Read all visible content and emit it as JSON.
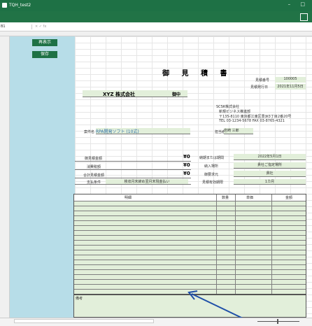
{
  "window": {
    "title": "TQH_test2"
  },
  "formula_bar": {
    "name_box": "B1",
    "fx": "× ✓ fx"
  },
  "side_buttons": {
    "redisplay": "再表示",
    "save": "保存"
  },
  "doc": {
    "title": "御 見 積 書",
    "estimate_no_label": "見積番号",
    "estimate_no": "100005",
    "issue_date_label": "見積発行日",
    "issue_date": "2021年11月5日",
    "client": "XYZ 株式会社",
    "honorific": "御中",
    "company": "SCSK株式会社",
    "dept": "新規ビジネス推進部",
    "address": "〒135-8110 東京都江東区豊洲3丁目2番20号",
    "tel": "TEL 03-1234-5678 FAX 03-8765-4321",
    "project_label": "案件名",
    "project": "RPA開発ソフト (10式)",
    "person_label": "担当者",
    "person": "岩崎 三郎",
    "total_label": "御見積金額",
    "total": "¥0",
    "tax_label": "消費税額",
    "tax": "¥0",
    "grand_label": "合計見積金額",
    "grand": "¥0",
    "payment_label": "支払条件",
    "payment": "検収月末締め翌月末現金払い",
    "delivery_date_label": "納期または期間",
    "delivery_date": "2022年5月1日",
    "delivery_place_label": "納入場所",
    "delivery_place": "貴社ご指定場所",
    "req_label": "御要求元",
    "req": "貴社",
    "valid_label": "見積有効期限",
    "valid": "1カ月",
    "col_item": "明細",
    "col_qty": "数量",
    "col_unit": "単価",
    "col_amount": "金額",
    "remarks_label": "備考"
  },
  "colors": {
    "excel_green": "#1e7145",
    "side_blue": "#b7dde8",
    "cell_green": "#e2efda"
  }
}
